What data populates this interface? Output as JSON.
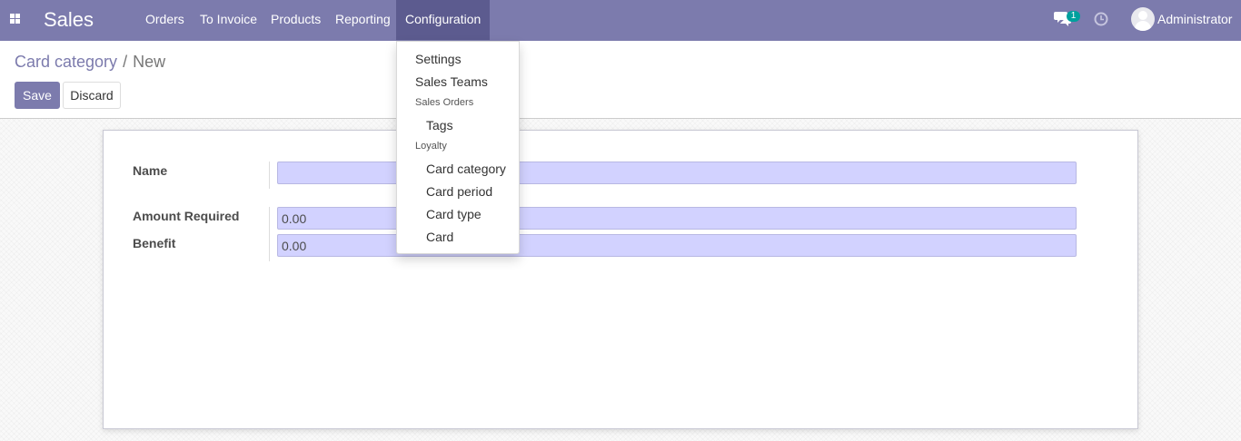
{
  "navbar": {
    "app_name": "Sales",
    "menu": [
      "Orders",
      "To Invoice",
      "Products",
      "Reporting",
      "Configuration"
    ],
    "active_menu": "Configuration",
    "chat_count": "1",
    "user_name": "Administrator",
    "icons": [
      "apps-grid-icon",
      "chat-icon",
      "clock-icon"
    ]
  },
  "breadcrumb": {
    "parent": "Card category",
    "separator": "/",
    "current": "New"
  },
  "buttons": {
    "save": "Save",
    "discard": "Discard"
  },
  "form": {
    "name_label": "Name",
    "name_value": "",
    "amount_label": "Amount Required",
    "amount_value": "0.00",
    "benefit_label": "Benefit",
    "benefit_value": "0.00"
  },
  "dropdown": {
    "settings": "Settings",
    "sales_teams": "Sales Teams",
    "sales_orders_header": "Sales Orders",
    "tags": "Tags",
    "loyalty_header": "Loyalty",
    "card_category": "Card category",
    "card_period": "Card period",
    "card_type": "Card type",
    "card": "Card"
  },
  "colors": {
    "navbar": "#7c7bad",
    "active_menu": "#5c5b8f",
    "required_field": "#d2d2ff",
    "badge": "#00a09d"
  }
}
